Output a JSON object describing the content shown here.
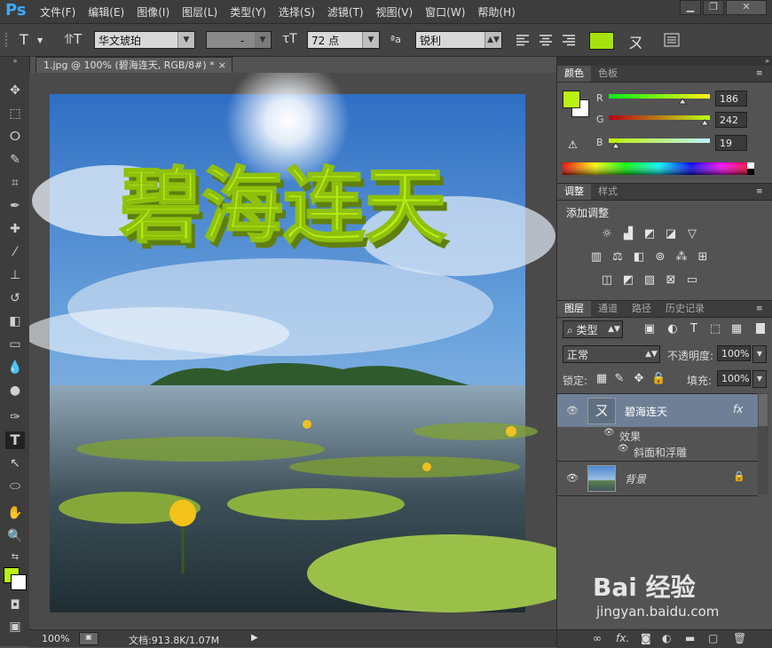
{
  "app": {
    "logo": "Ps"
  },
  "menu": [
    "文件(F)",
    "编辑(E)",
    "图像(I)",
    "图层(L)",
    "类型(Y)",
    "选择(S)",
    "滤镜(T)",
    "视图(V)",
    "窗口(W)",
    "帮助(H)"
  ],
  "window_controls": {
    "minimize": "▁",
    "restore": "❐",
    "close": "✕"
  },
  "options": {
    "font_family": "华文琥珀",
    "font_style": "-",
    "font_size": "72 点",
    "aa_label": "ªa",
    "antialias": "锐利",
    "text_color": "#a8e010"
  },
  "document": {
    "tab_title": "1.jpg @ 100% (碧海连天, RGB/8#) *",
    "close": "×",
    "canvas_text": "碧海连天",
    "zoom": "100%",
    "doc_info": "文档:913.8K/1.07M"
  },
  "color_panel": {
    "tabs": [
      "颜色",
      "色板"
    ],
    "r_label": "R",
    "g_label": "G",
    "b_label": "B",
    "r": "186",
    "g": "242",
    "b": "19",
    "r_frac": 0.73,
    "g_frac": 0.95,
    "b_frac": 0.07,
    "fg": "#baf213",
    "bg": "#ffffff"
  },
  "adjust_panel": {
    "tabs": [
      "调整",
      "样式"
    ],
    "title": "添加调整"
  },
  "layers_panel": {
    "tabs": [
      "图层",
      "通道",
      "路径",
      "历史记录"
    ],
    "filter": "类型",
    "blend": "正常",
    "opacity_label": "不透明度:",
    "opacity": "100%",
    "lock_label": "锁定:",
    "fill_label": "填充:",
    "fill": "100%",
    "layers": [
      {
        "name": "碧海连天",
        "fx": "fx",
        "effects_label": "效果",
        "effect": "斜面和浮雕"
      },
      {
        "name": "背景"
      }
    ]
  },
  "watermark": {
    "brand": "Bai  经验",
    "url": "jingyan.baidu.com"
  }
}
